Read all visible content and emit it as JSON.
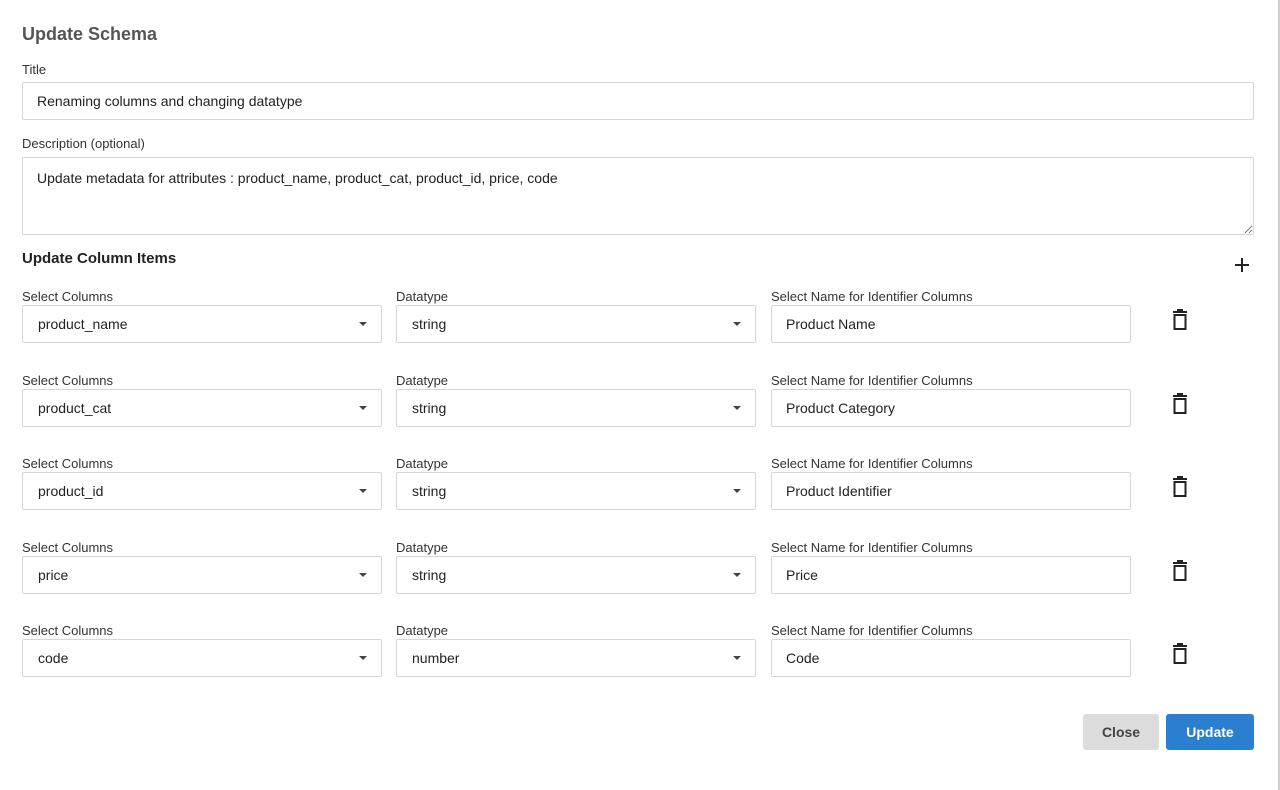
{
  "dialog": {
    "title": "Update Schema",
    "title_label": "Title",
    "title_value": "Renaming columns and changing datatype",
    "description_label": "Description (optional)",
    "description_value": "Update metadata for attributes : product_name, product_cat, product_id, price, code",
    "section_title": "Update Column Items",
    "add_icon": "plus-icon",
    "delete_icon": "trash-icon"
  },
  "rows": [
    {
      "col_label": "Select Columns",
      "column": "product_name",
      "type_label": "Datatype",
      "datatype": "string",
      "ident_label": "Select Name for Identifier Columns",
      "ident": "Product Name"
    },
    {
      "col_label": "Select Columns",
      "column": "product_cat",
      "type_label": "Datatype",
      "datatype": "string",
      "ident_label": "Select Name for Identifier Columns",
      "ident": "Product Category"
    },
    {
      "col_label": "Select Columns",
      "column": "product_id",
      "type_label": "Datatype",
      "datatype": "string",
      "ident_label": "Select Name for Identifier Columns",
      "ident": "Product Identifier"
    },
    {
      "col_label": "Select Columns",
      "column": "price",
      "type_label": "Datatype",
      "datatype": "string",
      "ident_label": "Select Name for Identifier Columns",
      "ident": "Price"
    },
    {
      "col_label": "Select Columns",
      "column": "code",
      "type_label": "Datatype",
      "datatype": "number",
      "ident_label": "Select Name for Identifier Columns",
      "ident": "Code"
    }
  ],
  "footer": {
    "close_label": "Close",
    "update_label": "Update"
  },
  "colors": {
    "primary": "#2b7fd0",
    "secondary": "#dcdcdc"
  }
}
